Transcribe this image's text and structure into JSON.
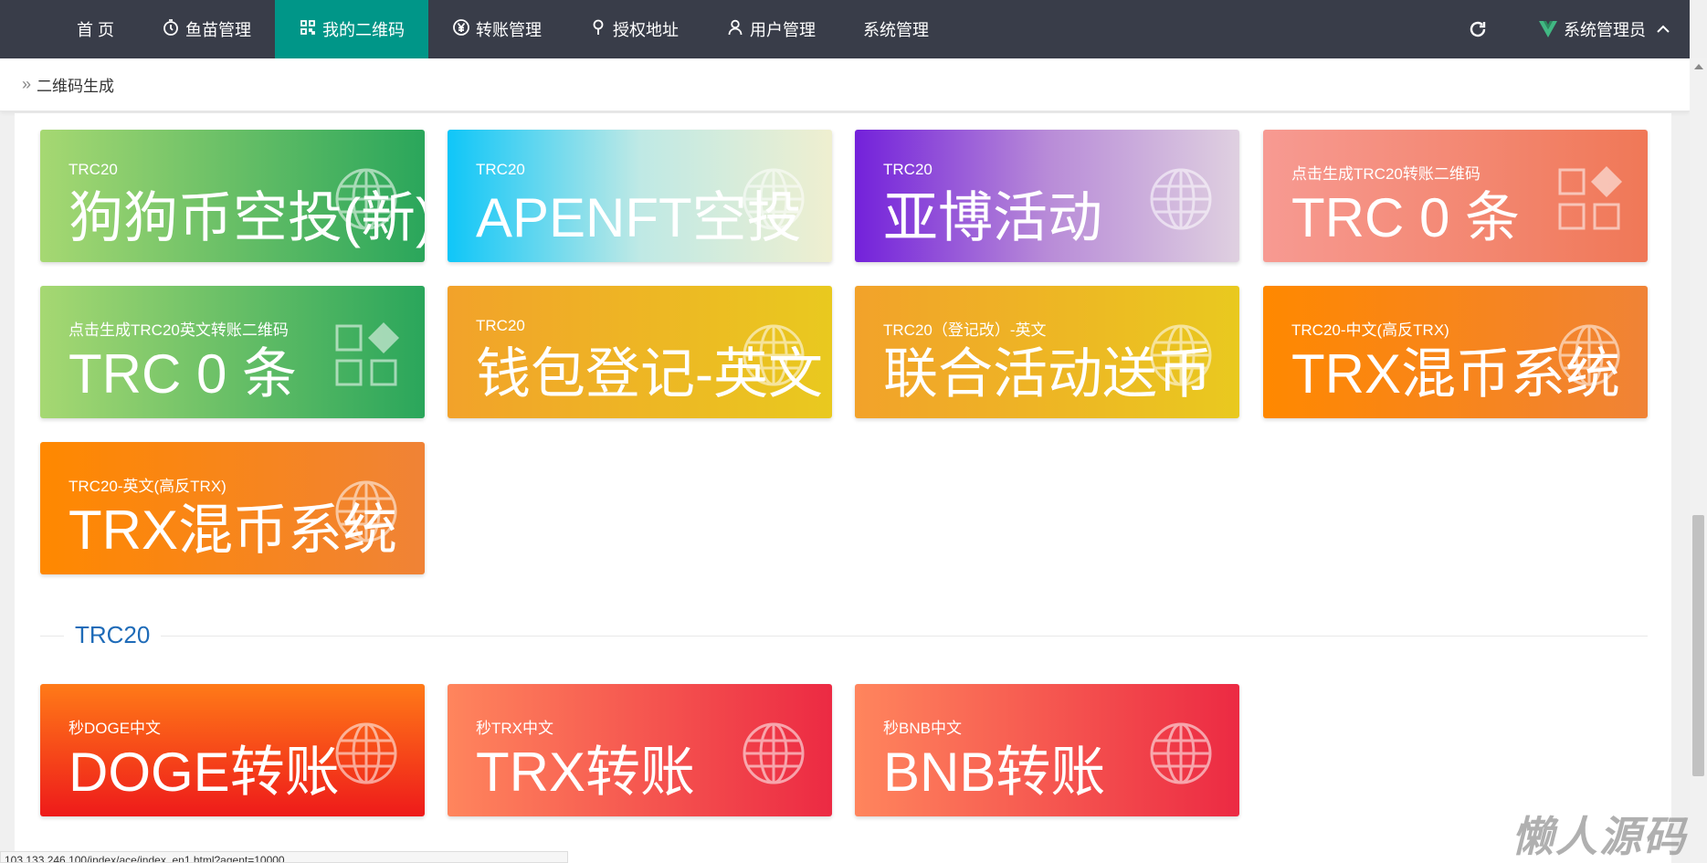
{
  "nav": {
    "items": [
      {
        "label": "首 页",
        "icon": "none",
        "active": false
      },
      {
        "label": "鱼苗管理",
        "icon": "timer-icon",
        "active": false
      },
      {
        "label": "我的二维码",
        "icon": "qrcode-icon",
        "active": true
      },
      {
        "label": "转账管理",
        "icon": "yen-icon",
        "active": false
      },
      {
        "label": "授权地址",
        "icon": "location-icon",
        "active": false
      },
      {
        "label": "用户管理",
        "icon": "user-icon",
        "active": false
      },
      {
        "label": "系统管理",
        "icon": "none",
        "active": false
      }
    ],
    "admin_label": "系统管理员"
  },
  "breadcrumb": {
    "label": "二维码生成"
  },
  "cards": [
    {
      "sub": "TRC20",
      "main": "狗狗币空投(新)",
      "theme": "green",
      "icon": "globe-icon"
    },
    {
      "sub": "TRC20",
      "main": "APENFT空投",
      "theme": "cyan",
      "icon": "globe-icon"
    },
    {
      "sub": "TRC20",
      "main": "亚博活动",
      "theme": "purple",
      "icon": "globe-icon"
    },
    {
      "sub": "点击生成TRC20转账二维码",
      "main": "TRC 0 条",
      "theme": "salmon",
      "icon": "apps-icon"
    },
    {
      "sub": "点击生成TRC20英文转账二维码",
      "main": "TRC 0 条",
      "theme": "green",
      "icon": "apps-icon"
    },
    {
      "sub": "TRC20",
      "main": "钱包登记-英文",
      "theme": "orange",
      "icon": "globe-icon"
    },
    {
      "sub": "TRC20（登记改）-英文",
      "main": "联合活动送币",
      "theme": "orange",
      "icon": "globe-icon"
    },
    {
      "sub": "TRC20-中文(高反TRX)",
      "main": "TRX混币系统",
      "theme": "orange2",
      "icon": "globe-icon"
    },
    {
      "sub": "TRC20-英文(高反TRX)",
      "main": "TRX混币系统",
      "theme": "orange2",
      "icon": "globe-icon"
    }
  ],
  "section": {
    "title": "TRC20"
  },
  "cards2": [
    {
      "sub": "秒DOGE中文",
      "main": "DOGE转账",
      "theme": "red",
      "icon": "globe-icon"
    },
    {
      "sub": "秒TRX中文",
      "main": "TRX转账",
      "theme": "pink",
      "icon": "globe-icon"
    },
    {
      "sub": "秒BNB中文",
      "main": "BNB转账",
      "theme": "pink",
      "icon": "globe-icon"
    }
  ],
  "statusbar": {
    "url": "103.133.246.100/index/ace/index_en1.html?agent=10000"
  },
  "watermark": {
    "text": "懒人源码"
  }
}
